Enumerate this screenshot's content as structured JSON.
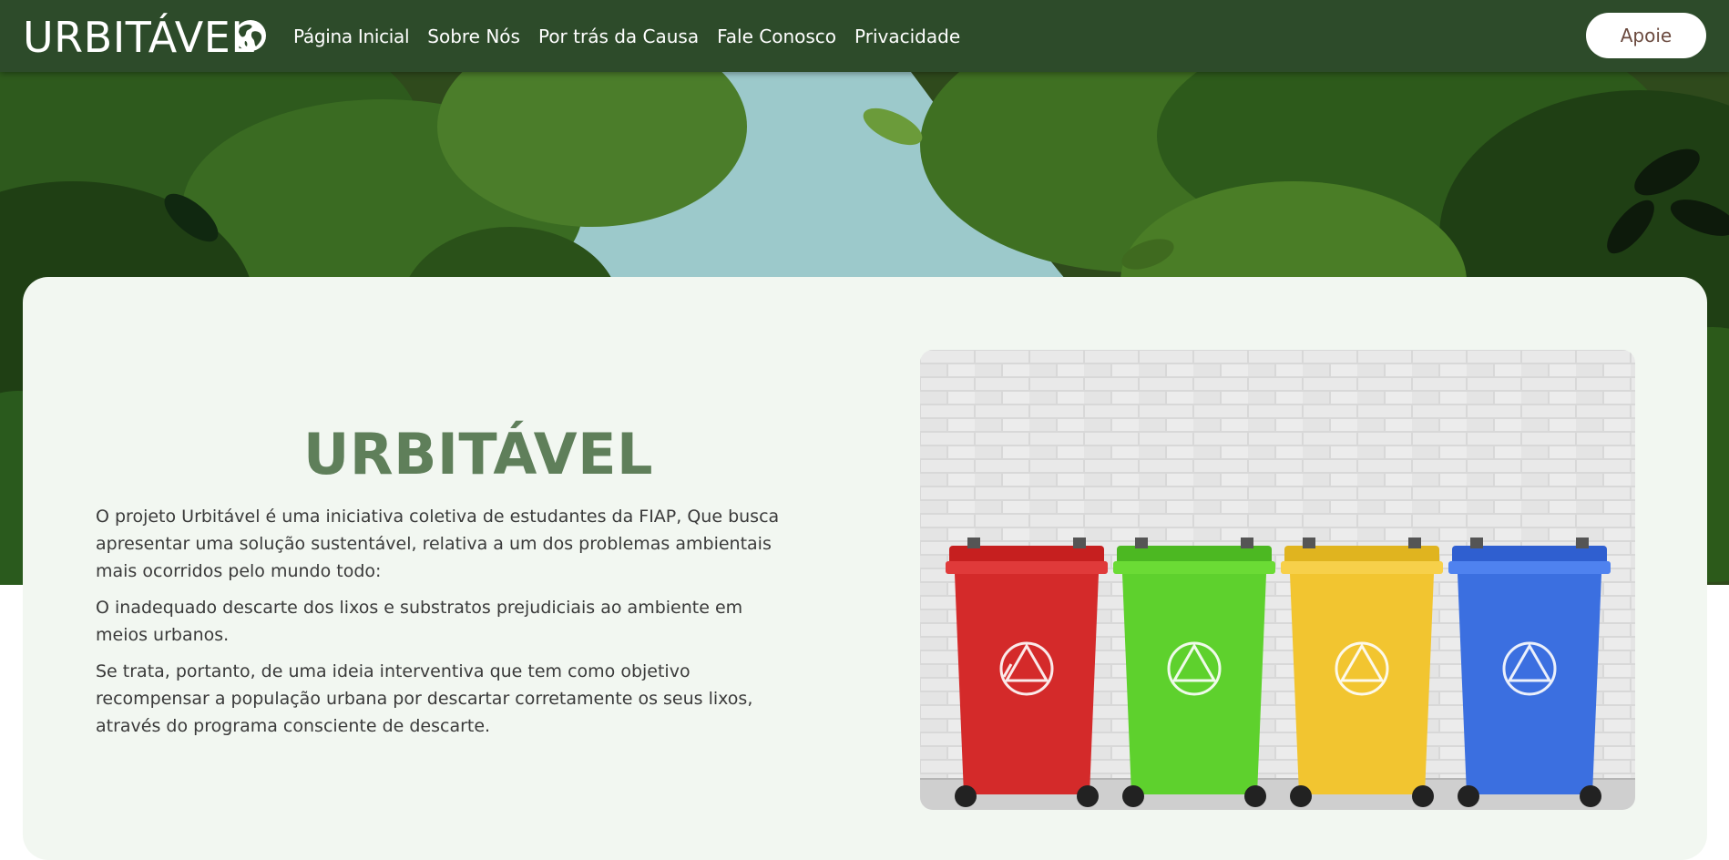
{
  "nav": {
    "logo": "URBITÁVEL",
    "links": [
      "Página Inicial",
      "Sobre Nós",
      "Por trás da Causa",
      "Fale Conosco",
      "Privacidade"
    ],
    "cta": "Apoie"
  },
  "about": {
    "title": "URBITÁVEL",
    "paragraphs": [
      "O projeto Urbitável é uma iniciativa coletiva de estudantes da FIAP, Que busca apresentar uma solução sustentável, relativa a um dos problemas ambientais mais ocorridos pelo mundo todo:",
      "O inadequado descarte dos lixos e substratos prejudiciais ao ambiente em meios urbanos.",
      "Se trata, portanto, de uma ideia interventiva que tem como objetivo recompensar a população urbana por descartar corretamente os seus lixos, através do programa consciente de descarte."
    ]
  },
  "colors": {
    "nav_bg": "#2d4b2a",
    "card_bg": "#f2f7f1",
    "title": "#5f7f5a",
    "bin_colors": [
      "#d42a2a",
      "#5ed12d",
      "#f2c530",
      "#3b6fe0"
    ]
  },
  "icons": [
    "globe-icon",
    "recycle-icon"
  ]
}
